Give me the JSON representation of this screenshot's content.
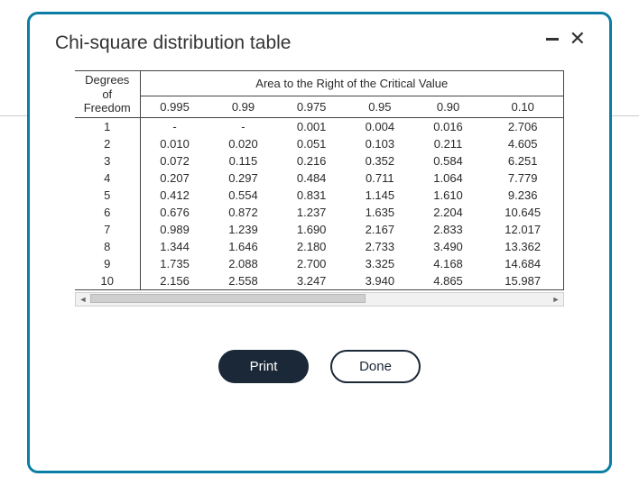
{
  "modal": {
    "title": "Chi-square distribution table",
    "buttons": {
      "print": "Print",
      "done": "Done"
    }
  },
  "table": {
    "df_header_line1": "Degrees of",
    "df_header_line2": "Freedom",
    "area_header": "Area to the Right of the Critical Value",
    "prob_headers": [
      "0.995",
      "0.99",
      "0.975",
      "0.95",
      "0.90",
      "0.10"
    ],
    "rows": [
      {
        "df": "1",
        "vals": [
          "-",
          "-",
          "0.001",
          "0.004",
          "0.016",
          "2.706"
        ]
      },
      {
        "df": "2",
        "vals": [
          "0.010",
          "0.020",
          "0.051",
          "0.103",
          "0.211",
          "4.605"
        ]
      },
      {
        "df": "3",
        "vals": [
          "0.072",
          "0.115",
          "0.216",
          "0.352",
          "0.584",
          "6.251"
        ]
      },
      {
        "df": "4",
        "vals": [
          "0.207",
          "0.297",
          "0.484",
          "0.711",
          "1.064",
          "7.779"
        ]
      },
      {
        "df": "5",
        "vals": [
          "0.412",
          "0.554",
          "0.831",
          "1.145",
          "1.610",
          "9.236"
        ]
      },
      {
        "df": "6",
        "vals": [
          "0.676",
          "0.872",
          "1.237",
          "1.635",
          "2.204",
          "10.645"
        ]
      },
      {
        "df": "7",
        "vals": [
          "0.989",
          "1.239",
          "1.690",
          "2.167",
          "2.833",
          "12.017"
        ]
      },
      {
        "df": "8",
        "vals": [
          "1.344",
          "1.646",
          "2.180",
          "2.733",
          "3.490",
          "13.362"
        ]
      },
      {
        "df": "9",
        "vals": [
          "1.735",
          "2.088",
          "2.700",
          "3.325",
          "4.168",
          "14.684"
        ]
      },
      {
        "df": "10",
        "vals": [
          "2.156",
          "2.558",
          "3.247",
          "3.940",
          "4.865",
          "15.987"
        ]
      }
    ]
  },
  "chart_data": {
    "type": "table",
    "title": "Chi-square distribution table",
    "columns": [
      "Degrees of Freedom",
      "0.995",
      "0.99",
      "0.975",
      "0.95",
      "0.90",
      "0.10"
    ],
    "column_group_label": "Area to the Right of the Critical Value",
    "rows": [
      [
        1,
        null,
        null,
        0.001,
        0.004,
        0.016,
        2.706
      ],
      [
        2,
        0.01,
        0.02,
        0.051,
        0.103,
        0.211,
        4.605
      ],
      [
        3,
        0.072,
        0.115,
        0.216,
        0.352,
        0.584,
        6.251
      ],
      [
        4,
        0.207,
        0.297,
        0.484,
        0.711,
        1.064,
        7.779
      ],
      [
        5,
        0.412,
        0.554,
        0.831,
        1.145,
        1.61,
        9.236
      ],
      [
        6,
        0.676,
        0.872,
        1.237,
        1.635,
        2.204,
        10.645
      ],
      [
        7,
        0.989,
        1.239,
        1.69,
        2.167,
        2.833,
        12.017
      ],
      [
        8,
        1.344,
        1.646,
        2.18,
        2.733,
        3.49,
        13.362
      ],
      [
        9,
        1.735,
        2.088,
        2.7,
        3.325,
        4.168,
        14.684
      ],
      [
        10,
        2.156,
        2.558,
        3.247,
        3.94,
        4.865,
        15.987
      ]
    ]
  }
}
